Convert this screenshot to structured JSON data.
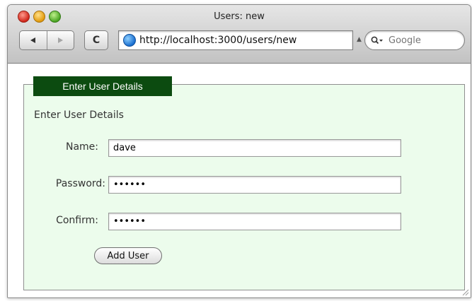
{
  "window": {
    "title": "Users: new"
  },
  "toolbar": {
    "back_icon": "back-arrow-icon",
    "forward_icon": "forward-arrow-icon",
    "reload_glyph": "C",
    "url": "http://localhost:3000/users/new",
    "search_placeholder": "Google"
  },
  "form": {
    "legend": "Enter User Details",
    "heading": "Enter User Details",
    "name_label": "Name:",
    "name_value": "dave",
    "password_label": "Password:",
    "password_value": "••••••",
    "confirm_label": "Confirm:",
    "confirm_value": "••••••",
    "submit_label": "Add User"
  },
  "colors": {
    "legend_bg": "#0c4b10",
    "panel_bg": "#ecfcec"
  }
}
